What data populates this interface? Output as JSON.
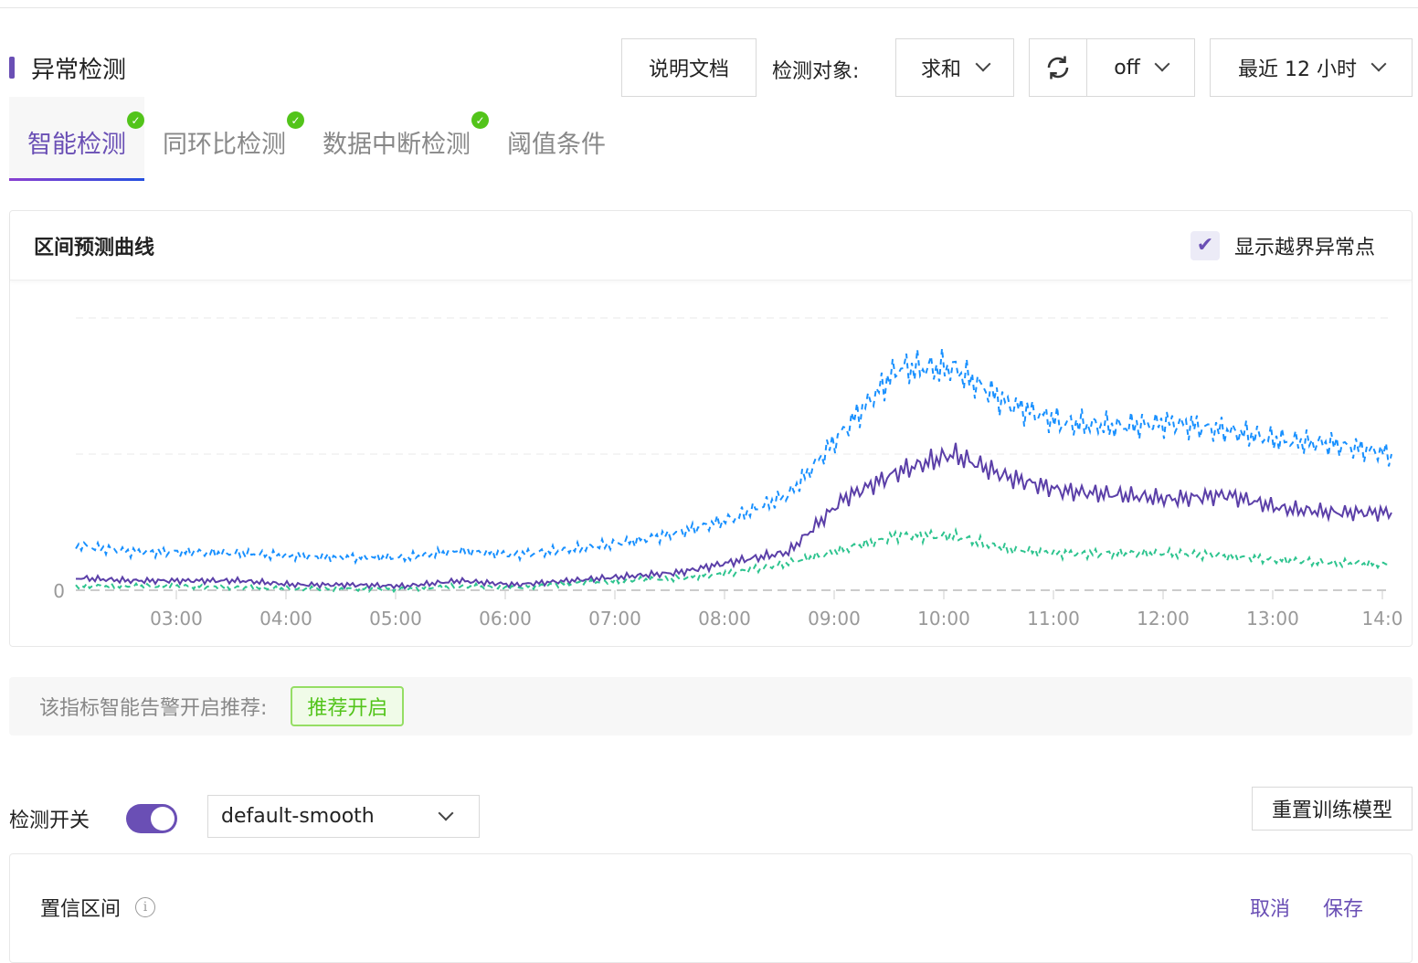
{
  "header": {
    "title": "异常检测",
    "doc_button": "说明文档",
    "target_label": "检测对象:",
    "target_value": "求和",
    "refresh_value": "off",
    "time_range": "最近 12 小时"
  },
  "tabs": [
    {
      "label": "智能检测",
      "active": true,
      "checked": true
    },
    {
      "label": "同环比检测",
      "checked": true
    },
    {
      "label": "数据中断检测",
      "checked": true
    },
    {
      "label": "阈值条件",
      "checked": false
    }
  ],
  "chart_card": {
    "title": "区间预测曲线",
    "show_outliers_label": "显示越界异常点",
    "show_outliers_checked": true
  },
  "chart_data": {
    "type": "line",
    "x": [
      "02:05",
      "02:35",
      "03:05",
      "03:35",
      "04:05",
      "04:35",
      "05:05",
      "05:35",
      "06:05",
      "06:35",
      "07:05",
      "07:35",
      "08:05",
      "08:35",
      "09:05",
      "09:35",
      "10:05",
      "10:35",
      "11:05",
      "11:35",
      "12:05",
      "12:35",
      "13:05",
      "13:35",
      "14:05"
    ],
    "x_tick_labels": [
      "03:00",
      "04:00",
      "05:00",
      "06:00",
      "07:00",
      "08:00",
      "09:00",
      "10:00",
      "11:00",
      "12:00",
      "13:00",
      "14:0"
    ],
    "y_tick_labels": [
      "0"
    ],
    "ylim": [
      0,
      2
    ],
    "grid": true,
    "series": [
      {
        "role": "upper-bound",
        "style": "dashed",
        "color": "#1890ff",
        "values": [
          0.33,
          0.28,
          0.28,
          0.27,
          0.25,
          0.24,
          0.24,
          0.29,
          0.26,
          0.3,
          0.35,
          0.42,
          0.53,
          0.7,
          1.17,
          1.63,
          1.63,
          1.37,
          1.23,
          1.2,
          1.23,
          1.17,
          1.1,
          1.07,
          1.0
        ]
      },
      {
        "role": "actual",
        "style": "solid",
        "color": "#5b3fa8",
        "values": [
          0.09,
          0.07,
          0.07,
          0.07,
          0.04,
          0.04,
          0.03,
          0.07,
          0.04,
          0.07,
          0.1,
          0.13,
          0.21,
          0.28,
          0.67,
          0.87,
          1.0,
          0.83,
          0.73,
          0.7,
          0.67,
          0.7,
          0.6,
          0.57,
          0.57
        ]
      },
      {
        "role": "lower-bound",
        "style": "dashed",
        "color": "#2ec48f",
        "values": [
          0.03,
          0.03,
          0.03,
          0.02,
          0.01,
          0.01,
          0.01,
          0.03,
          0.02,
          0.05,
          0.07,
          0.09,
          0.13,
          0.2,
          0.3,
          0.4,
          0.4,
          0.3,
          0.27,
          0.27,
          0.27,
          0.25,
          0.22,
          0.2,
          0.19
        ]
      }
    ]
  },
  "recommend": {
    "label": "该指标智能告警开启推荐:",
    "badge": "推荐开启"
  },
  "controls": {
    "switch_label": "检测开关",
    "switch_on": true,
    "model_select": "default-smooth",
    "reset_button": "重置训练模型"
  },
  "confidence": {
    "label": "置信区间",
    "info_icon": "i",
    "cancel": "取消",
    "save": "保存"
  }
}
